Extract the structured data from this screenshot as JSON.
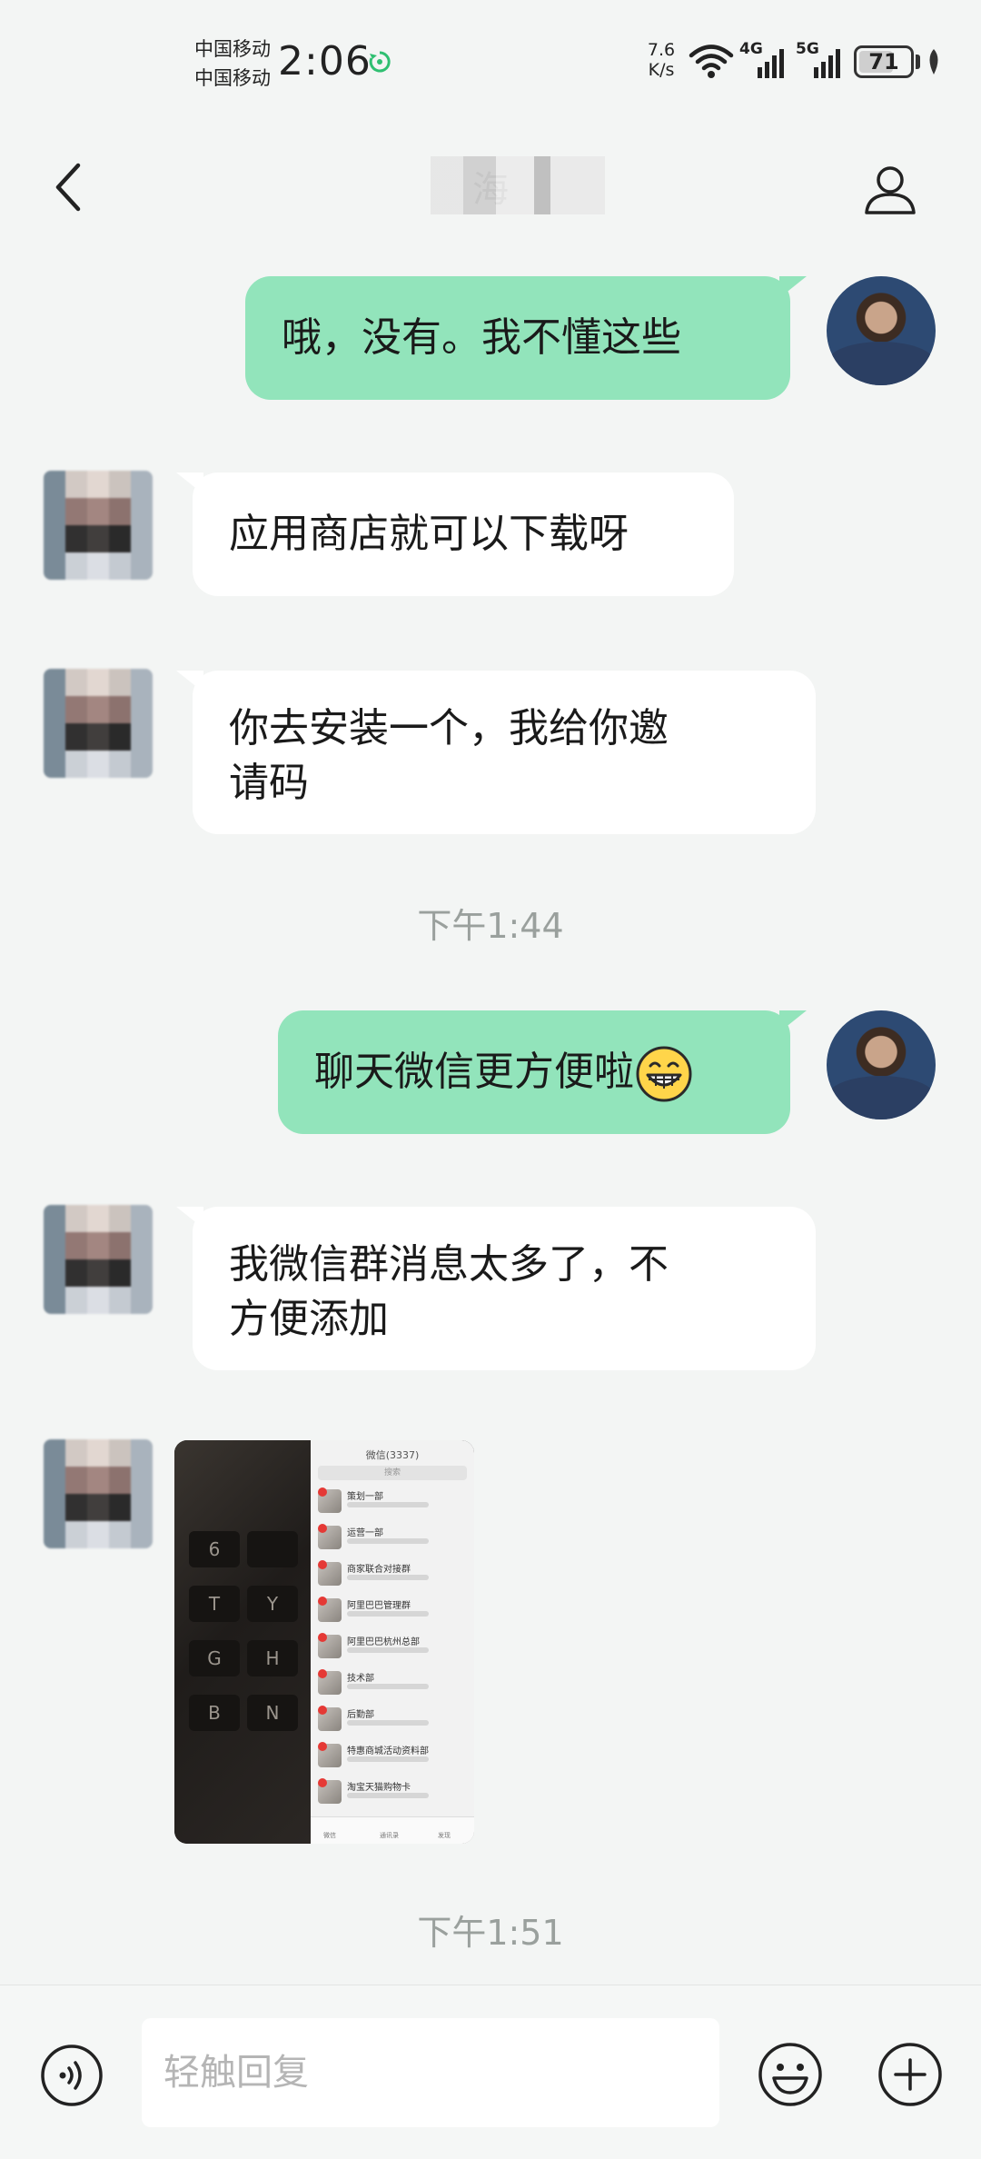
{
  "status_bar": {
    "carrier_1": "中国移动",
    "carrier_2": "中国移动",
    "time": "2:06",
    "net_speed_value": "7.6",
    "net_speed_unit": "K/s",
    "signal_1_label": "4G",
    "signal_2_label": "5G",
    "battery_level": "71",
    "battery_fraction": 0.71
  },
  "header": {
    "title": "海",
    "back_icon": "chevron-left-icon",
    "profile_icon": "person-icon"
  },
  "messages": [
    {
      "side": "me",
      "text": "哦，没有。我不懂这些"
    },
    {
      "side": "peer",
      "text": "应用商店就可以下载呀"
    },
    {
      "side": "peer",
      "text_line1": "你去安装一个，我给你邀",
      "text_line2": "请码"
    },
    {
      "side": "time",
      "text": "下午1:44"
    },
    {
      "side": "me",
      "text": "聊天微信更方便啦",
      "emoji": "grinning-face"
    },
    {
      "side": "peer",
      "text_line1": "我微信群消息太多了，不",
      "text_line2": "方便添加"
    },
    {
      "side": "peer",
      "type": "image",
      "screen_title": "微信(3337)",
      "screen_search": "搜索",
      "keys": [
        "6",
        "T",
        "Y",
        "G",
        "H",
        "B",
        "N"
      ],
      "chat_list": [
        "策划一部",
        "运营一部",
        "商家联合对接群",
        "阿里巴巴管理群",
        "阿里巴巴杭州总部",
        "技术部",
        "后勤部",
        "特惠商城活动资料部",
        "淘宝天猫购物卡"
      ],
      "tabs": [
        "微信",
        "通讯录",
        "发现"
      ]
    },
    {
      "side": "time",
      "text": "下午1:51"
    }
  ],
  "input_bar": {
    "placeholder": "轻触回复",
    "voice_icon": "voice-icon",
    "emoji_icon": "smiley-icon",
    "plus_icon": "plus-circle-icon"
  },
  "colors": {
    "my_bubble": "#92e4bb",
    "peer_bubble": "#ffffff",
    "background": "#f3f5f4"
  }
}
